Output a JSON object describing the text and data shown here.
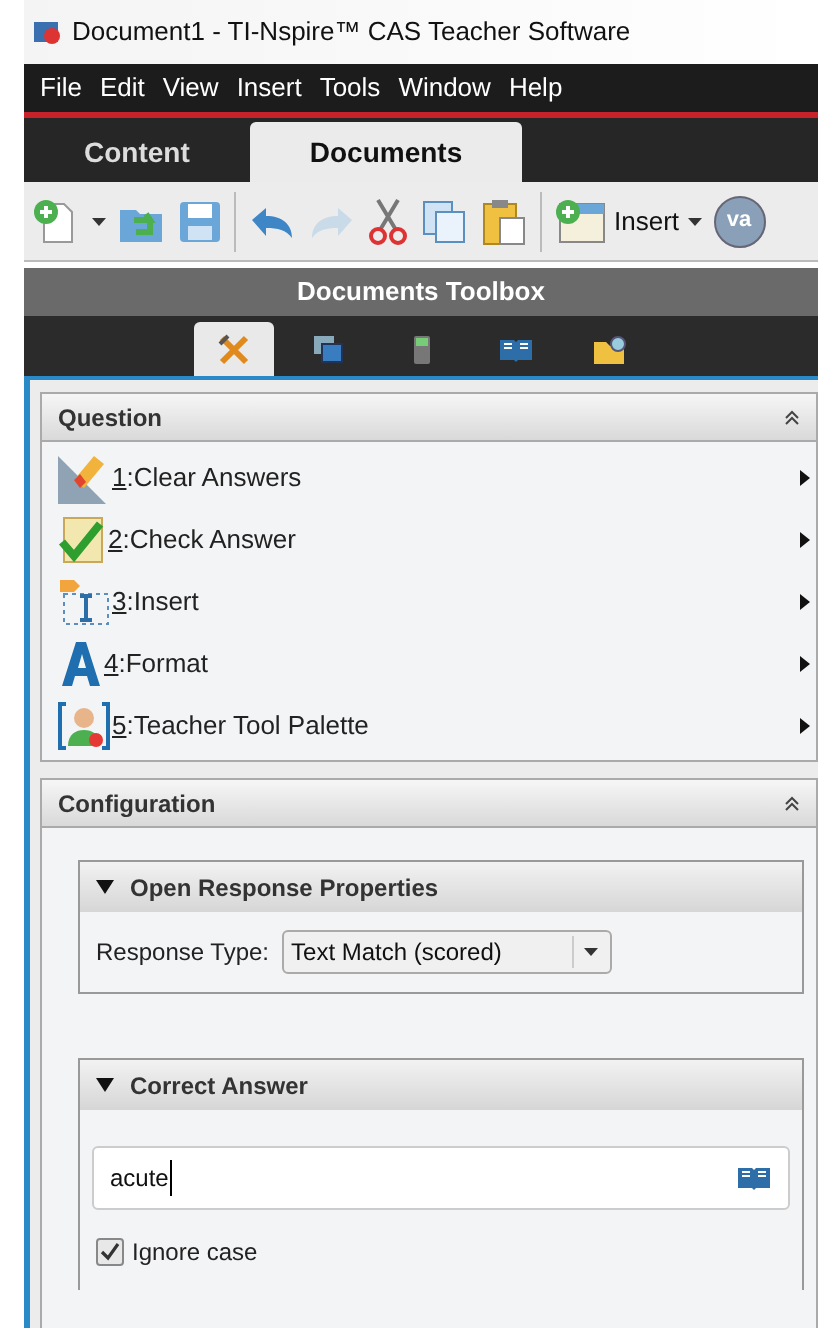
{
  "window": {
    "title": "Document1 - TI-Nspire™ CAS Teacher Software"
  },
  "menu": [
    "File",
    "Edit",
    "View",
    "Insert",
    "Tools",
    "Window",
    "Help"
  ],
  "tabs": [
    {
      "label": "Content",
      "selected": false
    },
    {
      "label": "Documents",
      "selected": true
    }
  ],
  "toolbar": {
    "insert_label": "Insert",
    "variable_label": "va"
  },
  "toolbox": {
    "title": "Documents Toolbox",
    "tabs": [
      {
        "kind": "tools",
        "selected": true
      },
      {
        "kind": "pages",
        "selected": false
      },
      {
        "kind": "calculator",
        "selected": false
      },
      {
        "kind": "book",
        "selected": false
      },
      {
        "kind": "folder",
        "selected": false
      }
    ]
  },
  "question": {
    "title": "Question",
    "items": [
      {
        "kind": "clear",
        "text": "1:Clear Answers"
      },
      {
        "kind": "check",
        "text": "2:Check Answer"
      },
      {
        "kind": "insert",
        "text": "3:Insert"
      },
      {
        "kind": "format",
        "text": "4:Format"
      },
      {
        "kind": "teacher",
        "text": "5:Teacher Tool Palette"
      }
    ]
  },
  "configuration": {
    "title": "Configuration",
    "open_response": {
      "title": "Open Response Properties",
      "expanded": true,
      "label": "Response Type:",
      "value": "Text Match (scored)"
    },
    "correct_answer": {
      "title": "Correct Answer",
      "expanded": true,
      "value": "acute",
      "ignore_case": {
        "label": "Ignore case",
        "checked": true
      }
    }
  }
}
